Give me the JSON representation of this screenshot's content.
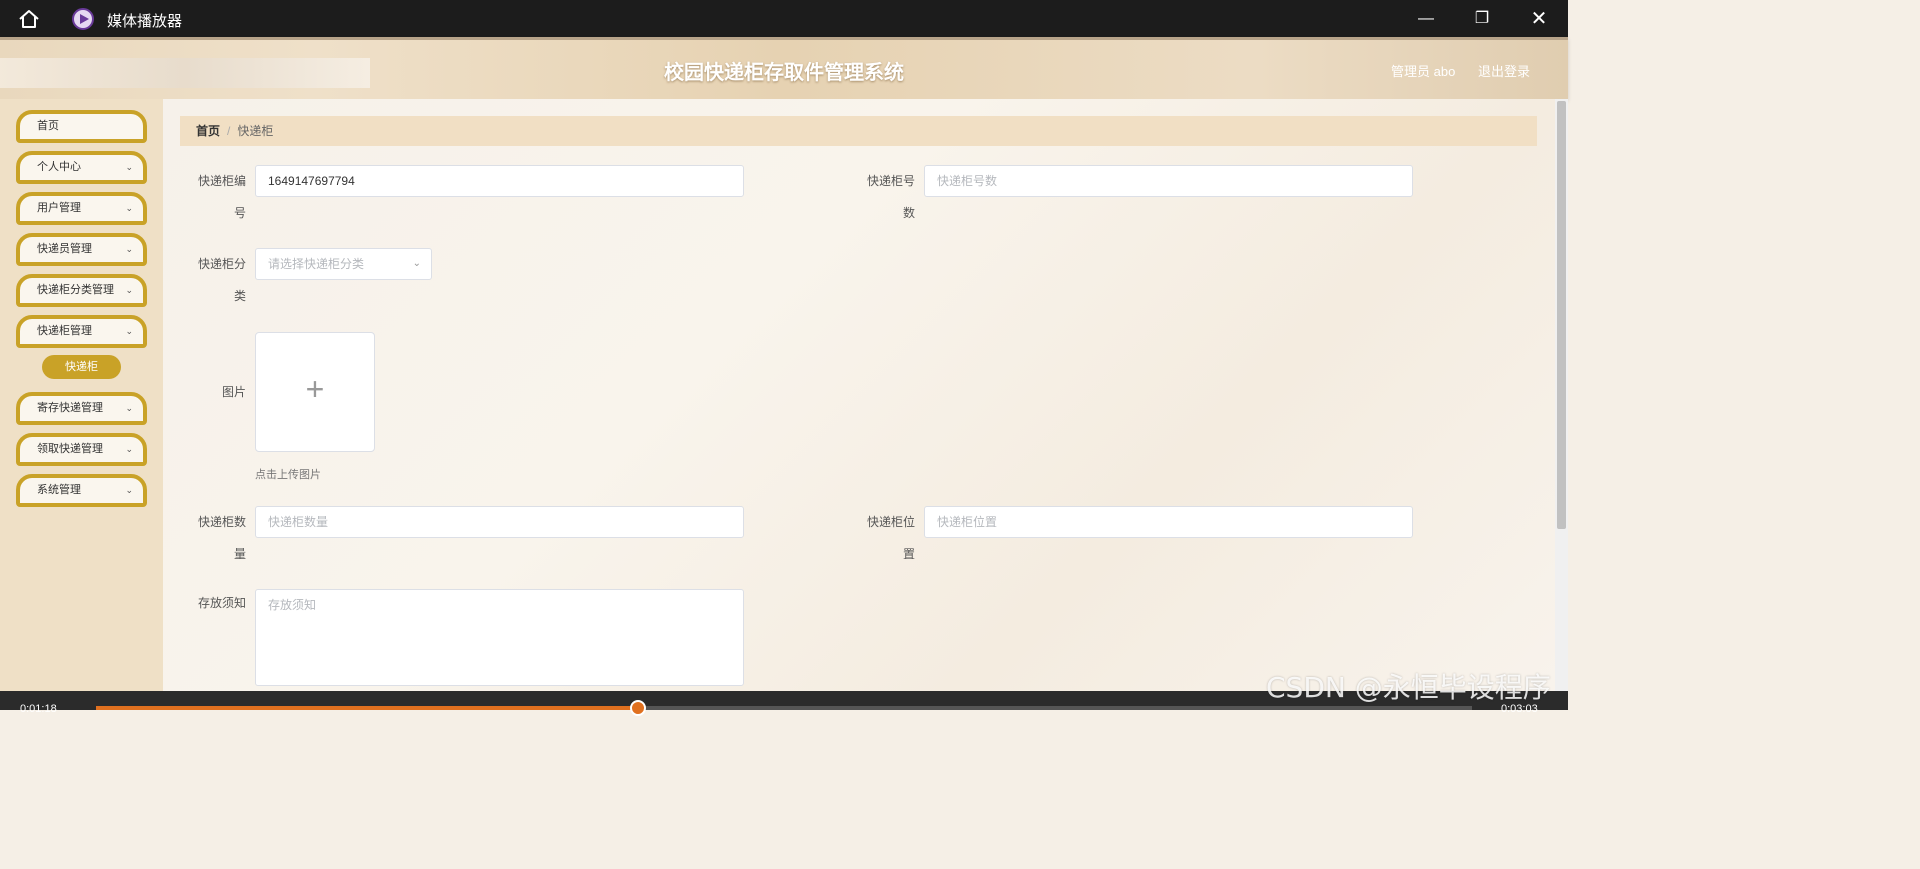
{
  "player": {
    "title": "媒体播放器",
    "time_elapsed": "0:01:18",
    "time_total": "0:03:03",
    "progress": 0.394
  },
  "header": {
    "system_title": "校园快递柜存取件管理系统",
    "user_label": "管理员 abo",
    "logout_label": "退出登录"
  },
  "sidebar": {
    "items": [
      {
        "label": "首页",
        "has_chevron": false
      },
      {
        "label": "个人中心",
        "has_chevron": true
      },
      {
        "label": "用户管理",
        "has_chevron": true
      },
      {
        "label": "快递员管理",
        "has_chevron": true
      },
      {
        "label": "快递柜分类管理",
        "has_chevron": true
      },
      {
        "label": "快递柜管理",
        "has_chevron": true
      },
      {
        "label": "寄存快递管理",
        "has_chevron": true
      },
      {
        "label": "领取快递管理",
        "has_chevron": true
      },
      {
        "label": "系统管理",
        "has_chevron": true
      }
    ],
    "active_sub": "快递柜"
  },
  "breadcrumb": {
    "home": "首页",
    "current": "快递柜"
  },
  "form": {
    "cabinet_no_label_1": "快递柜编",
    "cabinet_no_label_2": "号",
    "cabinet_no_value": "1649147697794",
    "slot_count_label_1": "快递柜号",
    "slot_count_label_2": "数",
    "slot_count_placeholder": "快递柜号数",
    "category_label_1": "快递柜分",
    "category_label_2": "类",
    "category_placeholder": "请选择快递柜分类",
    "image_label": "图片",
    "upload_tip": "点击上传图片",
    "quantity_label_1": "快递柜数",
    "quantity_label_2": "量",
    "quantity_placeholder": "快递柜数量",
    "location_label_1": "快递柜位",
    "location_label_2": "置",
    "location_placeholder": "快递柜位置",
    "notice_label": "存放须知",
    "notice_placeholder": "存放须知"
  },
  "watermark": "CSDN @永恒毕设程序",
  "colors": {
    "accent": "#c9a227",
    "player_progress": "#e0701f",
    "header_bg": "#e6d2b2"
  }
}
